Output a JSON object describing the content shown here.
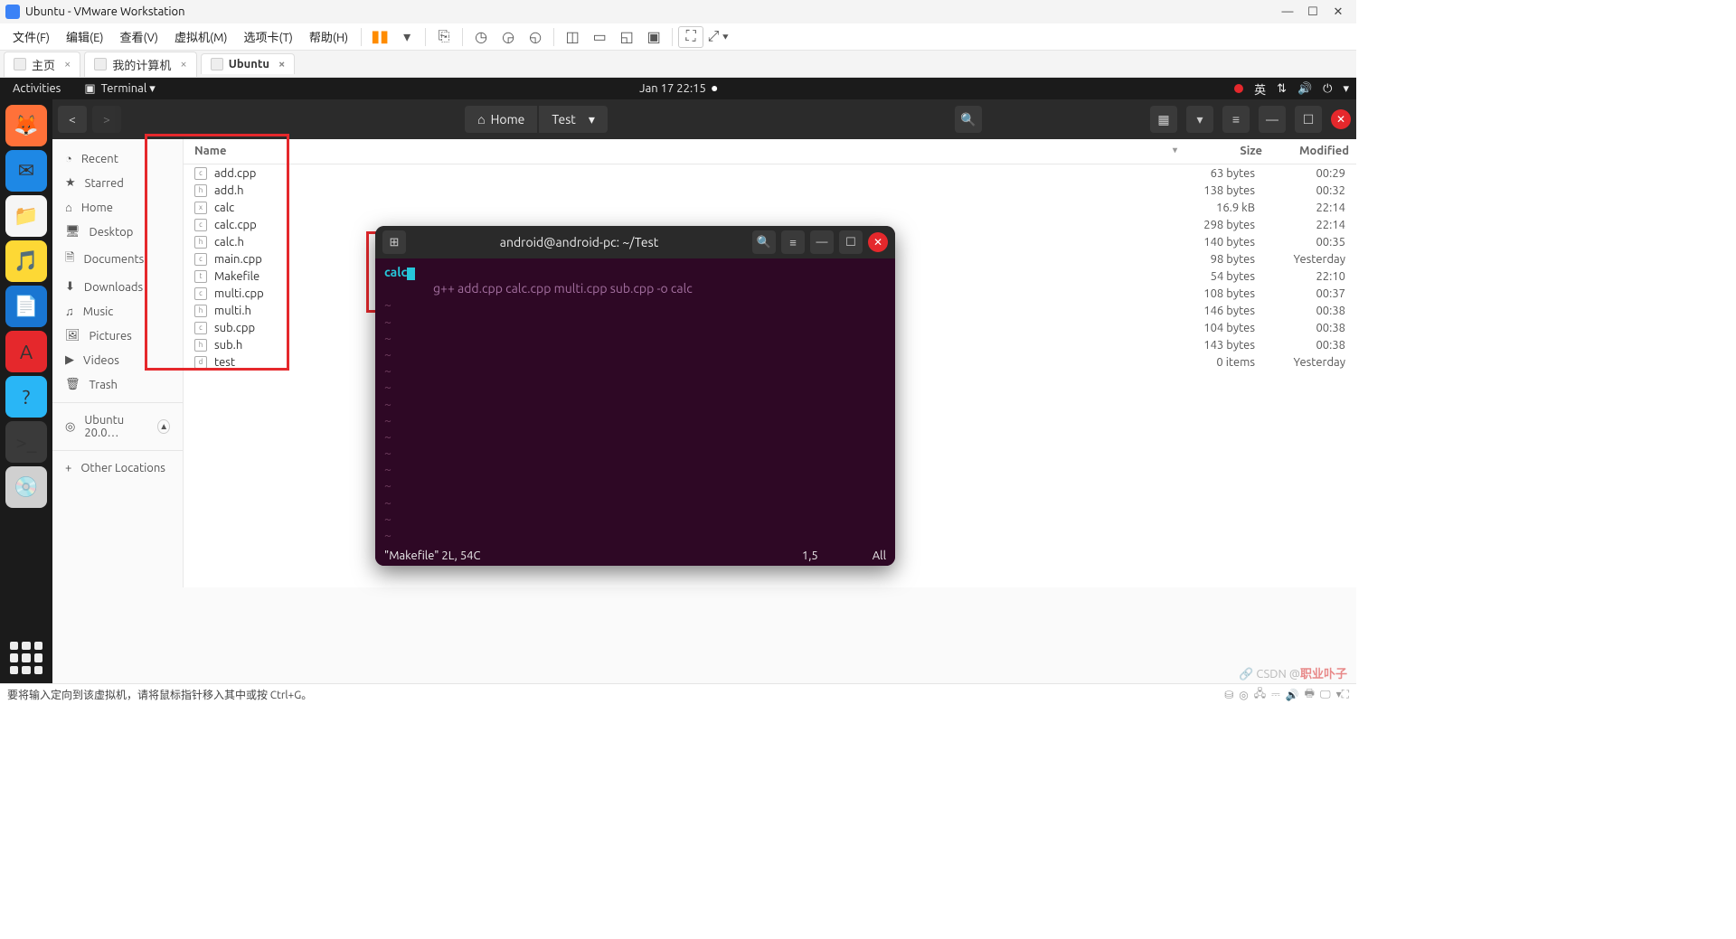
{
  "vmware": {
    "title": "Ubuntu - VMware Workstation",
    "menu": {
      "file": "文件(F)",
      "edit": "编辑(E)",
      "view": "查看(V)",
      "vm": "虚拟机(M)",
      "tabs": "选项卡(T)",
      "help": "帮助(H)"
    },
    "tabs": {
      "home": "主页",
      "my_computer": "我的计算机",
      "ubuntu": "Ubuntu"
    },
    "status": "要将输入定向到该虚拟机，请将鼠标指针移入其中或按 Ctrl+G。"
  },
  "gnome": {
    "activities": "Activities",
    "terminal_chip": "Terminal ▾",
    "clock": "Jan 17  22:15",
    "lang": "英"
  },
  "dock": [
    {
      "name": "firefox-icon",
      "bg": "#ff7139",
      "glyph": "🦊"
    },
    {
      "name": "thunderbird-icon",
      "bg": "#1e88e5",
      "glyph": "✉"
    },
    {
      "name": "files-icon",
      "bg": "#f5f5f5",
      "glyph": "📁"
    },
    {
      "name": "rhythmbox-icon",
      "bg": "#fdd835",
      "glyph": "🎵"
    },
    {
      "name": "libreoffice-icon",
      "bg": "#1976d2",
      "glyph": "📄"
    },
    {
      "name": "software-icon",
      "bg": "#e5282c",
      "glyph": "A"
    },
    {
      "name": "help-icon",
      "bg": "#29b6f6",
      "glyph": "?"
    },
    {
      "name": "terminal-icon",
      "bg": "#3a3a3a",
      "glyph": ">_"
    },
    {
      "name": "media-icon",
      "bg": "#d0d0d0",
      "glyph": "💿"
    }
  ],
  "files": {
    "breadcrumbs": {
      "home": "Home",
      "test": "Test"
    },
    "places": [
      {
        "icon": "◔",
        "label": "Recent"
      },
      {
        "icon": "★",
        "label": "Starred"
      },
      {
        "icon": "⌂",
        "label": "Home"
      },
      {
        "icon": "🖥",
        "label": "Desktop"
      },
      {
        "icon": "🗎",
        "label": "Documents"
      },
      {
        "icon": "⬇",
        "label": "Downloads"
      },
      {
        "icon": "♫",
        "label": "Music"
      },
      {
        "icon": "🖼",
        "label": "Pictures"
      },
      {
        "icon": "▶",
        "label": "Videos"
      },
      {
        "icon": "🗑",
        "label": "Trash"
      }
    ],
    "mount": {
      "icon": "◎",
      "label": "Ubuntu 20.0…"
    },
    "other": {
      "icon": "+",
      "label": "Other Locations"
    },
    "columns": {
      "name": "Name",
      "size": "Size",
      "modified": "Modified"
    },
    "rows": [
      {
        "kind": "c",
        "name": "add.cpp",
        "size": "63 bytes",
        "mod": "00:29"
      },
      {
        "kind": "h",
        "name": "add.h",
        "size": "138 bytes",
        "mod": "00:32"
      },
      {
        "kind": "x",
        "name": "calc",
        "size": "16.9 kB",
        "mod": "22:14"
      },
      {
        "kind": "c",
        "name": "calc.cpp",
        "size": "298 bytes",
        "mod": "22:14"
      },
      {
        "kind": "h",
        "name": "calc.h",
        "size": "140 bytes",
        "mod": "00:35"
      },
      {
        "kind": "c",
        "name": "main.cpp",
        "size": "98 bytes",
        "mod": "Yesterday"
      },
      {
        "kind": "t",
        "name": "Makefile",
        "size": "54 bytes",
        "mod": "22:10"
      },
      {
        "kind": "c",
        "name": "multi.cpp",
        "size": "108 bytes",
        "mod": "00:37"
      },
      {
        "kind": "h",
        "name": "multi.h",
        "size": "146 bytes",
        "mod": "00:38"
      },
      {
        "kind": "c",
        "name": "sub.cpp",
        "size": "104 bytes",
        "mod": "00:38"
      },
      {
        "kind": "h",
        "name": "sub.h",
        "size": "143 bytes",
        "mod": "00:38"
      },
      {
        "kind": "d",
        "name": "test",
        "size": "0 items",
        "mod": "Yesterday"
      }
    ]
  },
  "terminal": {
    "title": "android@android-pc: ~/Test",
    "calc": "calc",
    "cmd": "g++ add.cpp calc.cpp multi.cpp sub.cpp -o calc",
    "status_file": "\"Makefile\" 2L, 54C",
    "status_pos": "1,5",
    "status_all": "All"
  },
  "watermark": {
    "prefix": "CSDN @",
    "author": "职业卟子"
  }
}
